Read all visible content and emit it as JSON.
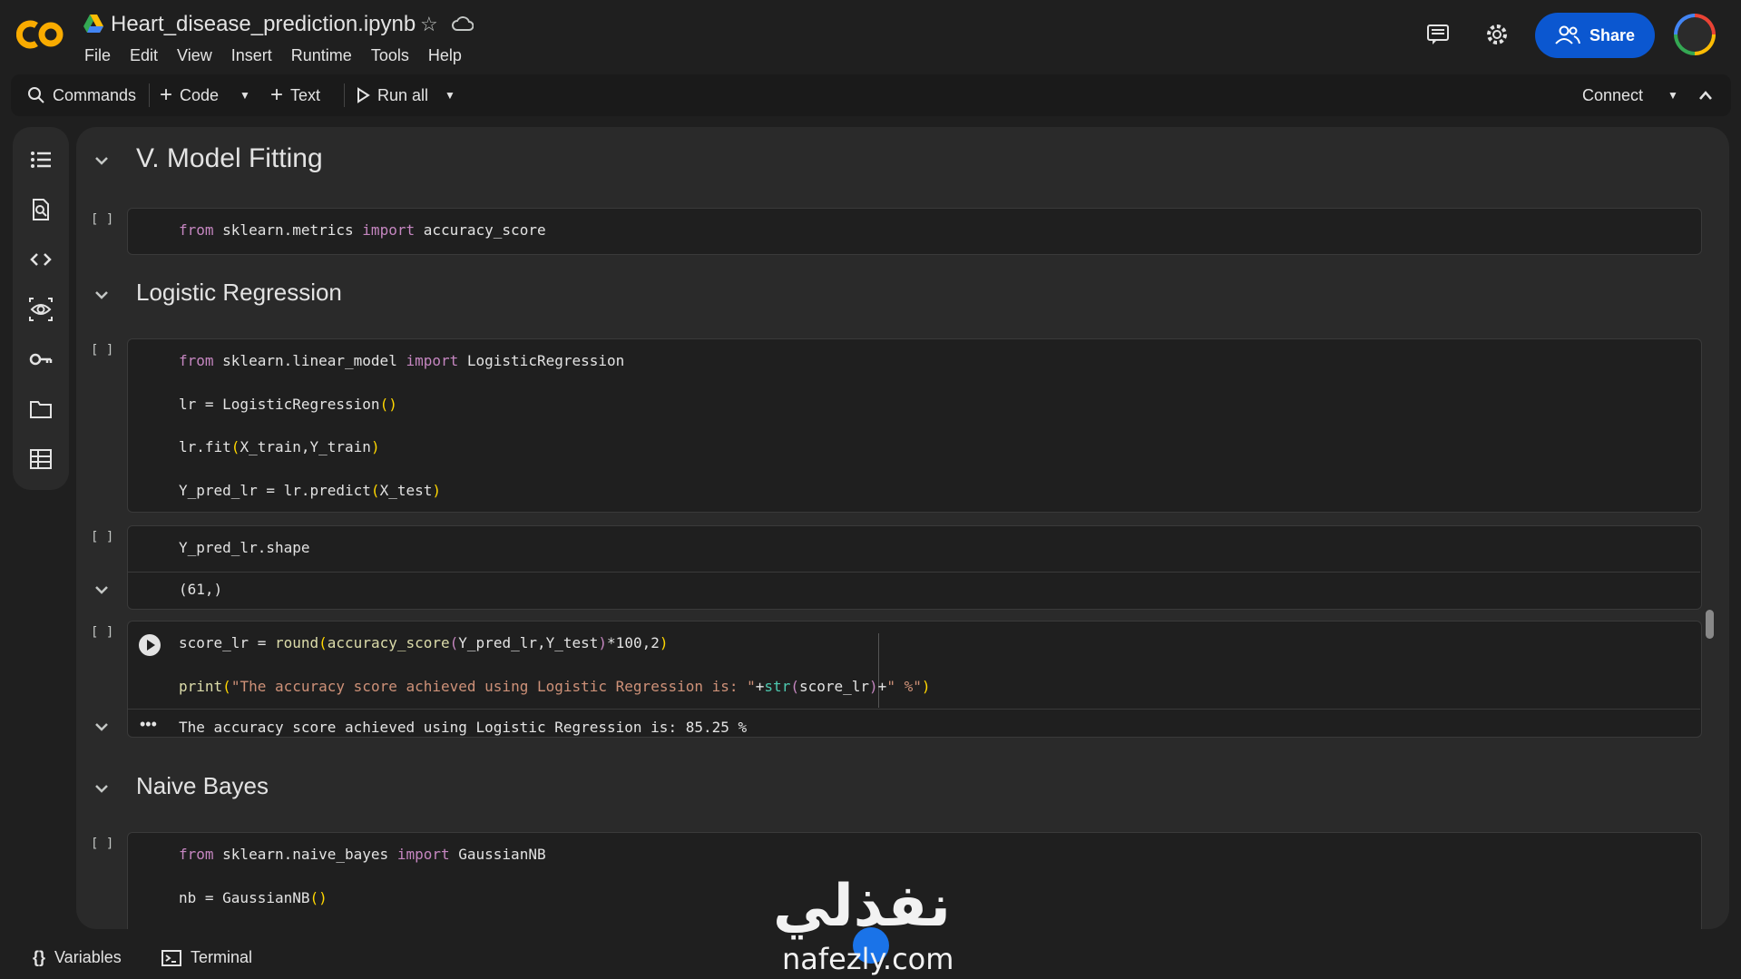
{
  "app": {
    "name": "Colab"
  },
  "header": {
    "title": "Heart_disease_prediction.ipynb",
    "menu": [
      "File",
      "Edit",
      "View",
      "Insert",
      "Runtime",
      "Tools",
      "Help"
    ],
    "share_label": "Share"
  },
  "toolbar": {
    "commands_label": "Commands",
    "code_label": "Code",
    "text_label": "Text",
    "run_all_label": "Run all",
    "connect_label": "Connect"
  },
  "sections": {
    "s1": "V. Model Fitting",
    "s2": "Logistic Regression",
    "s3": "Naive Bayes"
  },
  "cells": {
    "bracket": "[ ]",
    "c1": {
      "l1a": "from",
      "l1b": " sklearn.metrics ",
      "l1c": "import",
      "l1d": " accuracy_score"
    },
    "c2": {
      "l1a": "from",
      "l1b": " sklearn.linear_model ",
      "l1c": "import",
      "l1d": " LogisticRegression",
      "l2a": "lr = LogisticRegression",
      "l2b": "()",
      "l3a": "lr.fit",
      "l3b": "(",
      "l3c": "X_train,Y_train",
      "l3d": ")",
      "l4a": "Y_pred_lr = lr.predict",
      "l4b": "(",
      "l4c": "X_test",
      "l4d": ")"
    },
    "c3": {
      "code": "Y_pred_lr.shape",
      "output": "(61,)"
    },
    "c4": {
      "l1a": "score_lr = ",
      "l1b": "round",
      "l1c": "(",
      "l1d": "accuracy_score",
      "l1e": "(",
      "l1f": "Y_pred_lr,Y_test",
      "l1g": ")",
      "l1h": "*100,2",
      "l1i": ")",
      "l2a": "print",
      "l2b": "(",
      "l2c": "\"The accuracy score achieved using Logistic Regression is: \"",
      "l2d": "+",
      "l2e": "str",
      "l2f": "(",
      "l2g": "score_lr",
      "l2h": ")",
      "l2i": "+",
      "l2j": "\" %\"",
      "l2k": ")",
      "output": "The accuracy score achieved using Logistic Regression is: 85.25 %"
    },
    "c5": {
      "l1a": "from",
      "l1b": " sklearn.naive_bayes ",
      "l1c": "import",
      "l1d": " GaussianNB",
      "l2a": "nb = GaussianNB",
      "l2b": "()"
    }
  },
  "footer": {
    "variables_label": "Variables",
    "terminal_label": "Terminal"
  },
  "watermark": {
    "arabic": "نفذلي",
    "latin": "nafezly.com"
  },
  "colors": {
    "accent": "#0b57d0",
    "keyword": "#c586c0",
    "function": "#dcdcaa",
    "string": "#ce9178",
    "bracket": "#ffd700",
    "builtin": "#4ec9b0"
  }
}
